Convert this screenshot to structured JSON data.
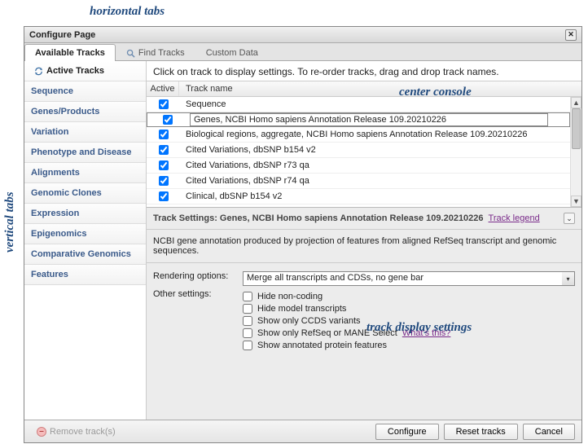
{
  "dialog": {
    "title": "Configure Page"
  },
  "htabs": {
    "available": "Available Tracks",
    "find": "Find Tracks",
    "custom": "Custom Data"
  },
  "vtabs": {
    "items": [
      {
        "label": "Active Tracks"
      },
      {
        "label": "Sequence"
      },
      {
        "label": "Genes/Products"
      },
      {
        "label": "Variation"
      },
      {
        "label": "Phenotype and Disease"
      },
      {
        "label": "Alignments"
      },
      {
        "label": "Genomic Clones"
      },
      {
        "label": "Expression"
      },
      {
        "label": "Epigenomics"
      },
      {
        "label": "Comparative Genomics"
      },
      {
        "label": "Features"
      }
    ]
  },
  "hint": "Click on track to display settings. To re-order tracks, drag and drop track names.",
  "columns": {
    "active": "Active",
    "name": "Track name"
  },
  "rows": [
    {
      "name": "Sequence"
    },
    {
      "name": "Genes, NCBI Homo sapiens Annotation Release 109.20210226"
    },
    {
      "name": "Biological regions, aggregate, NCBI Homo sapiens Annotation Release 109.20210226"
    },
    {
      "name": "Cited Variations, dbSNP b154 v2"
    },
    {
      "name": "Cited Variations, dbSNP r73 qa"
    },
    {
      "name": "Cited Variations, dbSNP r74 qa"
    },
    {
      "name": "Clinical, dbSNP b154 v2"
    }
  ],
  "settings": {
    "prefix": "Track Settings: ",
    "title": "Genes, NCBI Homo sapiens Annotation Release 109.20210226",
    "legend": "Track legend",
    "description": "NCBI gene annotation produced by projection of features from aligned RefSeq transcript and genomic sequences.",
    "rendering_label": "Rendering options:",
    "rendering_value": "Merge all transcripts and CDSs, no gene bar",
    "other_label": "Other settings:",
    "opts": {
      "hide_noncoding": "Hide non-coding",
      "hide_model": "Hide model transcripts",
      "ccds": "Show only CCDS variants",
      "refseq": "Show only RefSeq or MANE Select",
      "whats_this": "What's this?",
      "protein": "Show annotated protein features"
    }
  },
  "footer": {
    "remove": "Remove track(s)",
    "configure": "Configure",
    "reset": "Reset tracks",
    "cancel": "Cancel"
  },
  "annot": {
    "htabs": "horizontal tabs",
    "vtabs": "vertical tabs",
    "console": "center console",
    "display": "track display settings"
  }
}
